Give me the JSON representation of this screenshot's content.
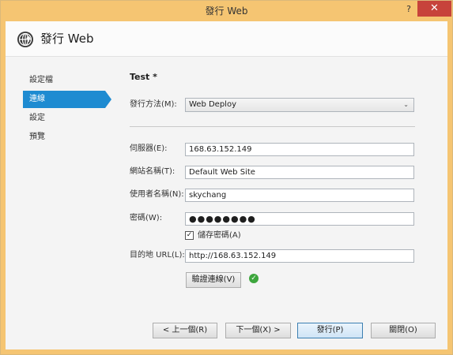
{
  "window": {
    "title": "發行 Web",
    "help": "?",
    "close": "✕"
  },
  "header": {
    "title": "發行 Web",
    "icon": "globe-upload-icon"
  },
  "sidebar": {
    "items": [
      {
        "label": "設定檔"
      },
      {
        "label": "連線",
        "active": true
      },
      {
        "label": "設定"
      },
      {
        "label": "預覽"
      }
    ]
  },
  "main": {
    "profile_name": "Test *",
    "publish_method": {
      "label": "發行方法(M):",
      "value": "Web Deploy"
    },
    "server": {
      "label": "伺服器(E):",
      "value": "168.63.152.149"
    },
    "site_name": {
      "label": "網站名稱(T):",
      "value": "Default Web Site"
    },
    "username": {
      "label": "使用者名稱(N):",
      "value": "skychang"
    },
    "password": {
      "label": "密碼(W):",
      "value": "●●●●●●●●"
    },
    "save_password": {
      "label": "儲存密碼(A)",
      "checked": true
    },
    "dest_url": {
      "label": "目的地 URL(L):",
      "value": "http://168.63.152.149"
    },
    "validate_button": "驗證連線(V)",
    "validate_status": "success-check-icon"
  },
  "footer": {
    "prev": "< 上一個(R)",
    "next": "下一個(X) >",
    "publish": "發行(P)",
    "close": "關閉(O)"
  },
  "colors": {
    "title_bar": "#f5c572",
    "accent": "#1e8bd1",
    "close": "#c7433b",
    "success": "#3da63d"
  }
}
